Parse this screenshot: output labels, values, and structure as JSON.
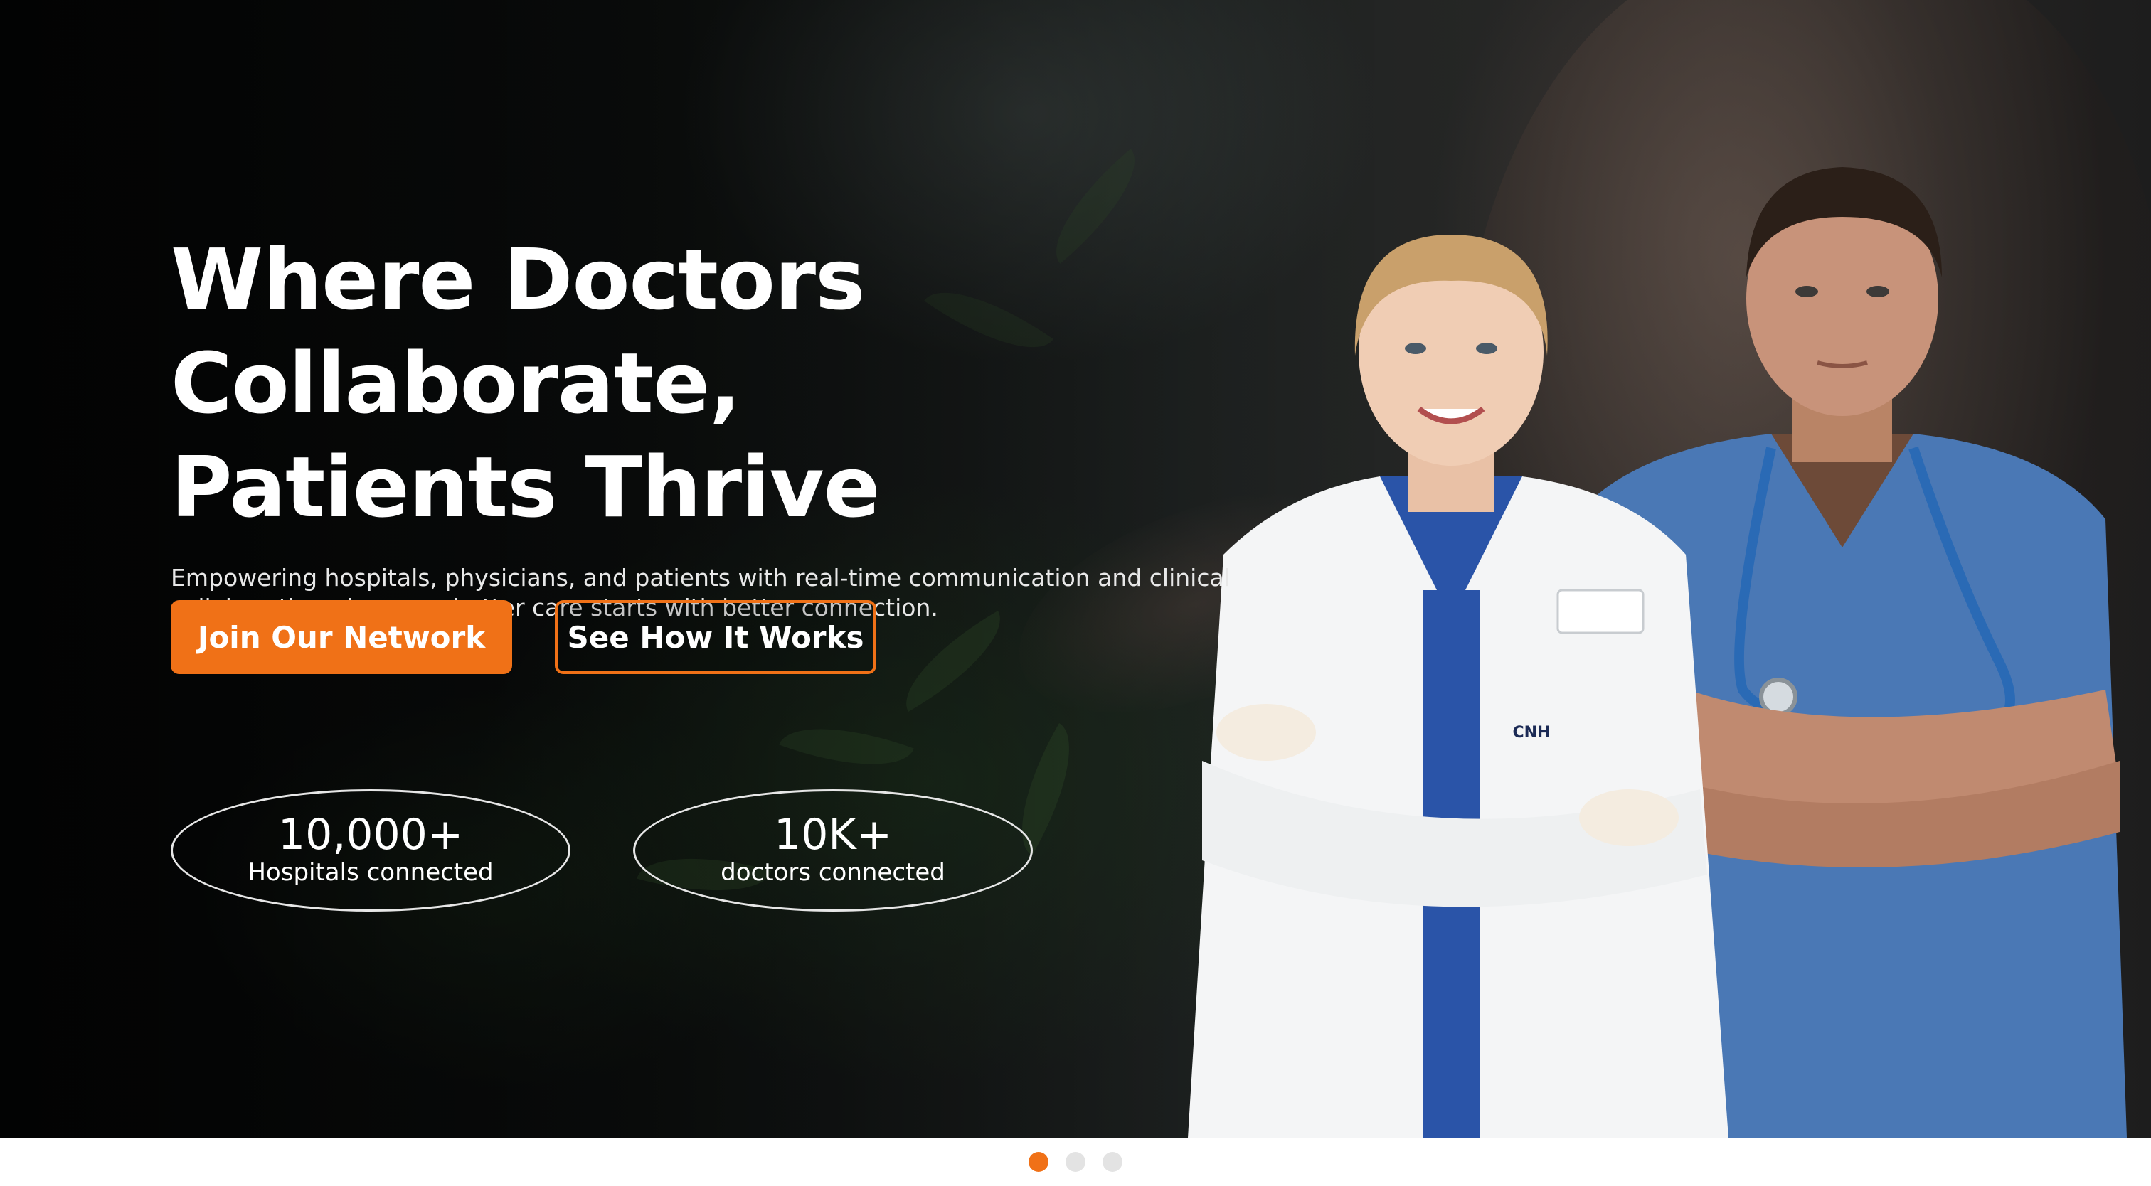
{
  "hero": {
    "headline_line1": "Where Doctors Collaborate,",
    "headline_line2": "Patients Thrive",
    "subtext_line1": "Empowering hospitals, physicians, and patients with real-time communication and clinical",
    "subtext_line2": "collaboration—because better care starts with better connection.",
    "primary_button": "Join Our Network",
    "secondary_button": "See How It Works",
    "badge_text": "CNH"
  },
  "stats": [
    {
      "value": "10,000+",
      "label": "Hospitals connected"
    },
    {
      "value": "10K+",
      "label": "doctors connected"
    }
  ],
  "carousel": {
    "slide_count": 3,
    "active_index": 0
  },
  "colors": {
    "accent": "#f07117",
    "background": "#0b0d0c",
    "text": "#ffffff",
    "dot_inactive": "#e3e3e3"
  }
}
